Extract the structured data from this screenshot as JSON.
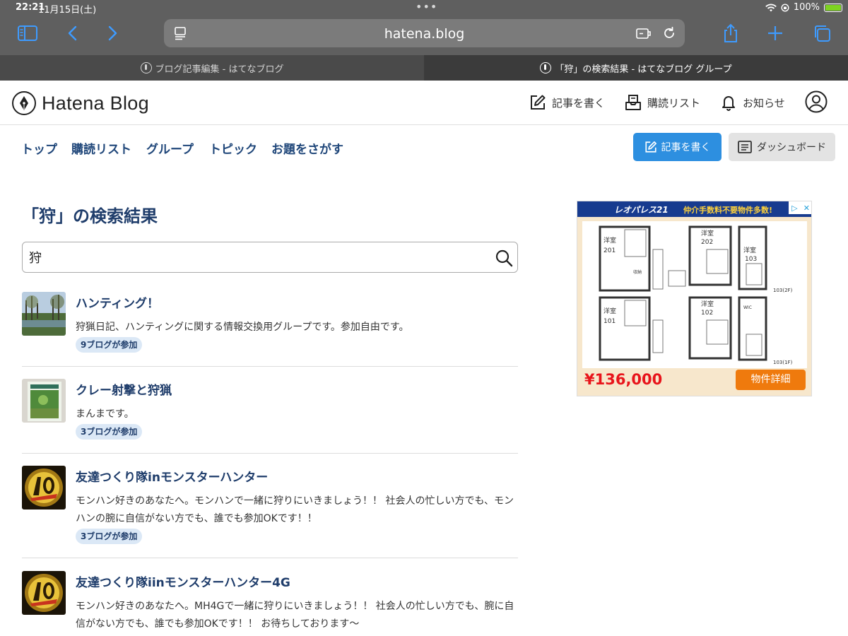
{
  "status": {
    "time": "22:21",
    "date": "11月15日(土)",
    "battery": "100%"
  },
  "browser": {
    "address": "hatena.blog",
    "tabs": [
      {
        "title": "ブログ記事編集 - はてなブログ",
        "active": false
      },
      {
        "title": "「狩」の検索結果 - はてなブログ グループ",
        "active": true
      }
    ]
  },
  "header": {
    "logo_text": "Hatena Blog",
    "write_label": "記事を書く",
    "reading_list_label": "購読リスト",
    "notifications_label": "お知らせ"
  },
  "subnav": {
    "links": [
      "トップ",
      "購読リスト",
      "グループ",
      "トピック",
      "お題をさがす"
    ],
    "write_button": "記事を書く",
    "dashboard_button": "ダッシュボード"
  },
  "main": {
    "page_title": "「狩」の検索結果",
    "search_value": "狩",
    "results": [
      {
        "title": "ハンティング！",
        "description": "狩猟日記、ハンティングに関する情報交換用グループです。参加自由です。",
        "badge": "9ブログが参加"
      },
      {
        "title": "クレー射撃と狩猟",
        "description": "まんまです。",
        "badge": "3ブログが参加"
      },
      {
        "title": "友達つくり隊inモンスターハンター",
        "description": "モンハン好きのあなたへ。モンハンで一緒に狩りにいきましょう！！ 社会人の忙しい方でも、モンハンの腕に自信がない方でも、誰でも参加OKです！！",
        "badge": "3ブログが参加"
      },
      {
        "title": "友達つくり隊iinモンスターハンター4G",
        "description": "モンハン好きのあなたへ。MH4Gで一緒に狩りにいきましょう！！ 社会人の忙しい方でも、腕に自信がない方でも、誰でも参加OKです！！ お待ちしております〜",
        "badge": ""
      }
    ]
  },
  "ad": {
    "brand": "レオパレス21",
    "tagline": "仲介手数料不要物件多数!",
    "price": "¥136,000",
    "cta": "物件詳細",
    "rooms": [
      "洋室",
      "201",
      "洋室",
      "202",
      "洋室",
      "103",
      "洋室",
      "101",
      "洋室",
      "102",
      "103(2F)",
      "103(1F)",
      "収納",
      "WIC"
    ]
  },
  "colors": {
    "accent": "#2d8fe0",
    "link": "#1f3d6b",
    "badge_bg": "#dbe8f6",
    "ad_price": "#e8141b",
    "ad_cta": "#ef7a0d"
  }
}
